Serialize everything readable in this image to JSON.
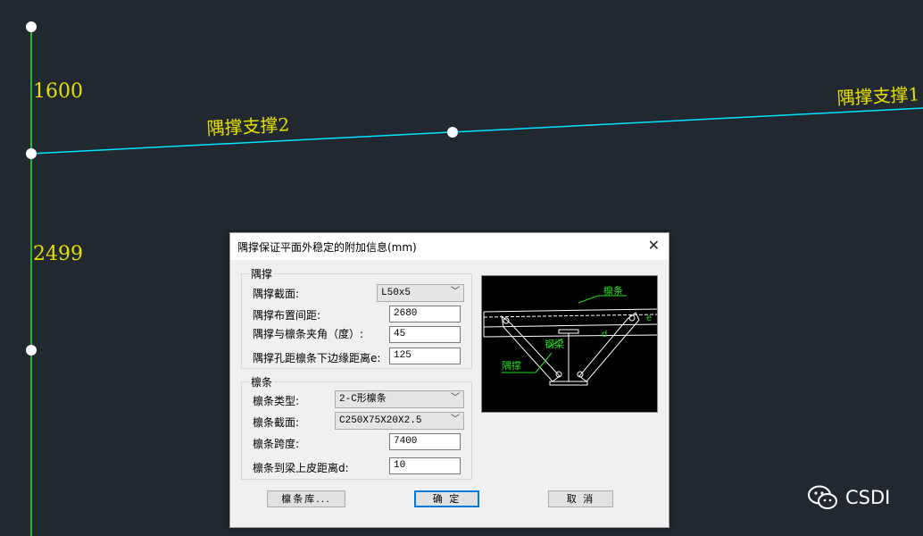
{
  "cad": {
    "dim_top": "1600",
    "dim_bottom": "2499",
    "label_left": "隅撑支撑2",
    "label_right": "隅撑支撑1"
  },
  "dialog": {
    "title": "隅撑保证平面外稳定的附加信息(mm)",
    "close_glyph": "✕",
    "group_brace": {
      "label": "隅撑",
      "section_label": "隅撑截面:",
      "section_value": "L50x5",
      "spacing_label": "隅撑布置间距:",
      "spacing_value": "2680",
      "angle_label": "隅撑与檩条夹角（度）:",
      "angle_value": "45",
      "hole_label": "隅撑孔距檩条下边缘距离e:",
      "hole_value": "125"
    },
    "group_purlin": {
      "label": "檩条",
      "type_label": "檩条类型:",
      "type_value": "2-C形檩条",
      "section_label": "檩条截面:",
      "section_value": "C250X75X20X2.5",
      "span_label": "檩条跨度:",
      "span_value": "7400",
      "dist_label": "檩条到梁上皮距离d:",
      "dist_value": "10"
    },
    "preview": {
      "purlin_label": "檩条",
      "beam_label": "钢梁",
      "brace_label": "隅撑",
      "e_label": "e",
      "d_label": "d"
    },
    "buttons": {
      "library": "檩条库...",
      "ok": "确 定",
      "cancel": "取 消"
    }
  },
  "watermark": {
    "text": "CSDI"
  },
  "colors": {
    "background": "#212830",
    "line_cyan": "#00e5ff",
    "line_green": "#2ee62e",
    "text_yellow": "#e6e000",
    "preview_green": "#22dd22"
  }
}
